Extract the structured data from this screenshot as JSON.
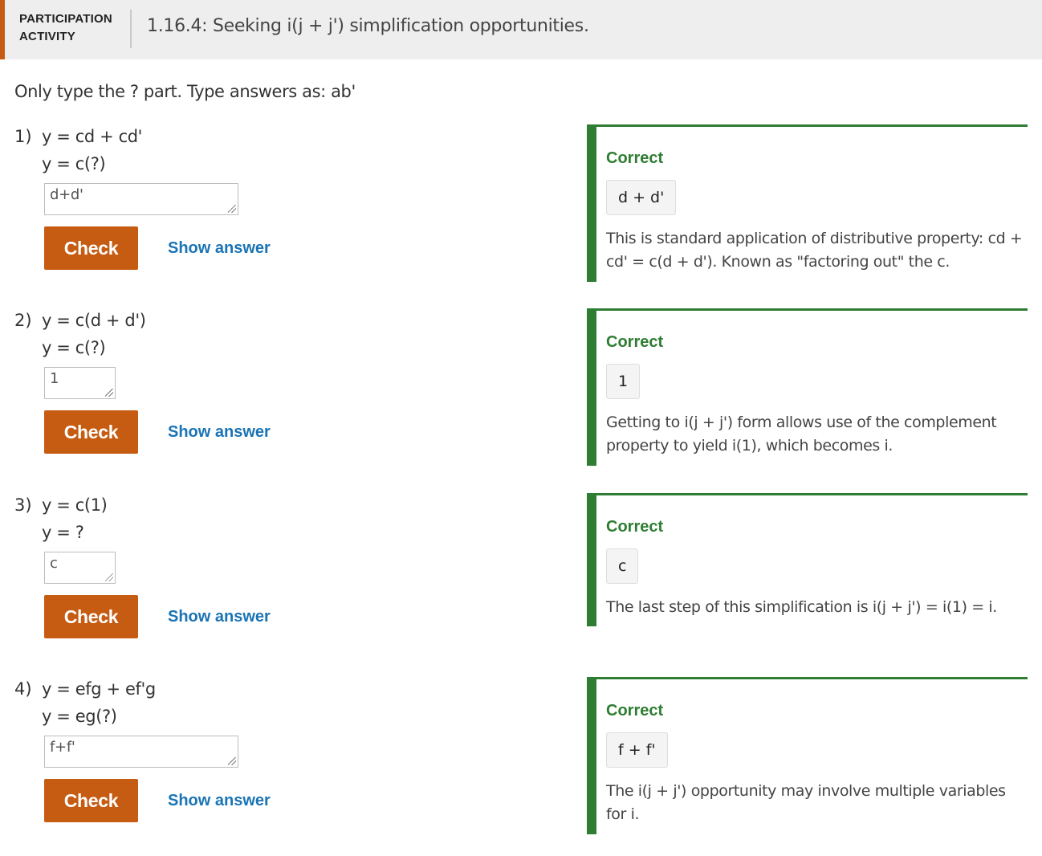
{
  "header": {
    "activity_label": "PARTICIPATION ACTIVITY",
    "title": "1.16.4: Seeking i(j + j') simplification opportunities.",
    "accent_color": "#c65b12"
  },
  "instructions": "Only type the ? part. Type answers as: ab'",
  "questions": [
    {
      "number": "1)",
      "line1": "y = cd + cd'",
      "line2": "y = c(?)",
      "input_value": "d+d'",
      "check_label": "Check",
      "show_answer_label": "Show answer",
      "feedback": {
        "status": "Correct",
        "answer": "d + d'",
        "explanation": "This is standard application of distributive property: cd + cd' = c(d + d'). Known as \"factoring out\" the c."
      }
    },
    {
      "number": "2)",
      "line1": "y = c(d + d')",
      "line2": "y = c(?)",
      "input_value": "1",
      "check_label": "Check",
      "show_answer_label": "Show answer",
      "feedback": {
        "status": "Correct",
        "answer": "1",
        "explanation": "Getting to i(j + j') form allows use of the complement property to yield i(1), which becomes i."
      }
    },
    {
      "number": "3)",
      "line1": "y = c(1)",
      "line2": "y = ?",
      "input_value": "c",
      "check_label": "Check",
      "show_answer_label": "Show answer",
      "feedback": {
        "status": "Correct",
        "answer": "c",
        "explanation": "The last step of this simplification is i(j + j') = i(1) = i."
      }
    },
    {
      "number": "4)",
      "line1": "y = efg + ef'g",
      "line2": "y = eg(?)",
      "input_value": "f+f'",
      "check_label": "Check",
      "show_answer_label": "Show answer",
      "feedback": {
        "status": "Correct",
        "answer": "f + f'",
        "explanation": "The i(j + j') opportunity may involve multiple variables for i."
      }
    }
  ],
  "colors": {
    "check_button": "#c65b12",
    "link": "#1a74b5",
    "correct": "#2e7d32"
  }
}
